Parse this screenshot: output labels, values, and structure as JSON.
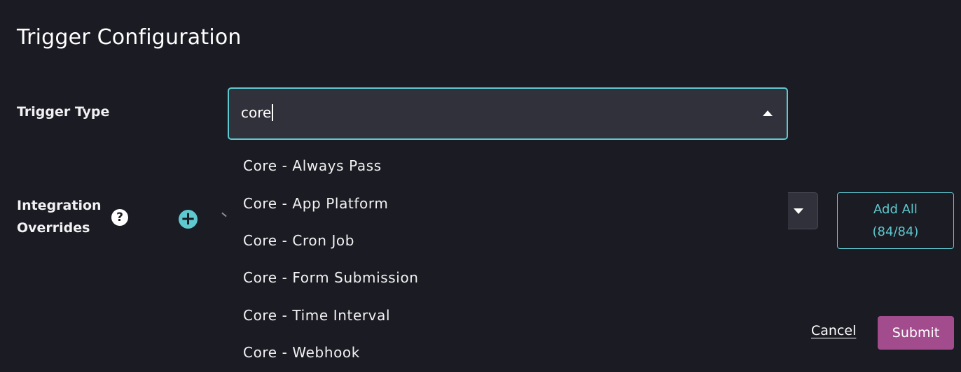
{
  "header": {
    "title": "Trigger Configuration"
  },
  "trigger_type": {
    "label": "Trigger Type",
    "input_value": "core",
    "options": [
      "Core - Always Pass",
      "Core - App Platform",
      "Core - Cron Job",
      "Core - Form Submission",
      "Core - Time Interval",
      "Core - Webhook"
    ]
  },
  "integration_overrides": {
    "label_line1": "Integration",
    "label_line2": "Overrides",
    "help_icon": "question-circle-icon",
    "add_icon": "plus-circle-icon",
    "add_all_label": "Add All",
    "add_all_count": "(84/84)"
  },
  "footer": {
    "cancel_label": "Cancel",
    "submit_label": "Submit"
  },
  "colors": {
    "background": "#1b1b23",
    "accent": "#5ec9cf",
    "submit": "#a34c8d",
    "input_bg": "#31313b"
  }
}
